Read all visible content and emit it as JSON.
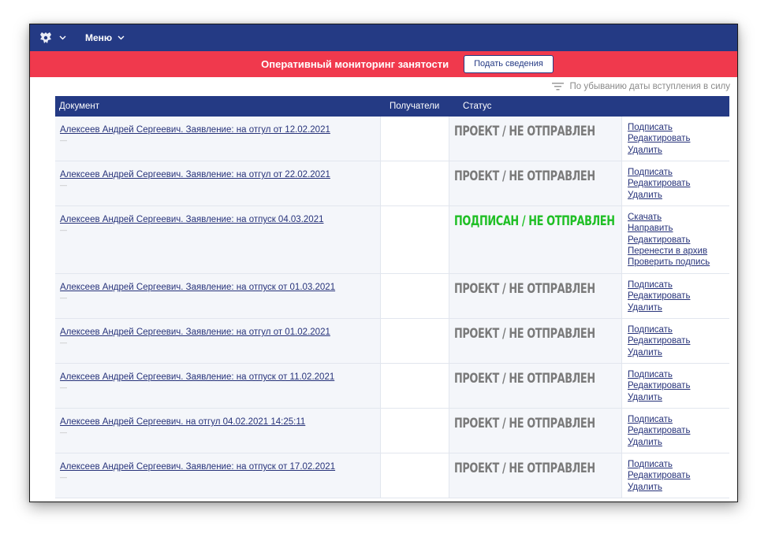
{
  "header": {
    "menu_label": "Меню",
    "emblem_icon": "russian-eagle-icon"
  },
  "banner": {
    "title": "Оперативный мониторинг занятости",
    "button_label": "Подать сведения"
  },
  "sort": {
    "label": "По убыванию даты вступления в силу",
    "icon": "sort-lines-icon"
  },
  "columns": {
    "document": "Документ",
    "recipients": "Получатели",
    "status": "Статус"
  },
  "colors": {
    "navy": "#243a84",
    "red": "#f0394d",
    "draft_status": "#7a7a7a",
    "signed_status": "#1fbf25",
    "link": "#27337a"
  },
  "rows": [
    {
      "title": "Алексеев Андрей Сергеевич. Заявление: на отгул от 12.02.2021",
      "sub": "—",
      "status": "ПРОЕКТ / НЕ ОТПРАВЛЕН",
      "status_kind": "draft",
      "actions": [
        "Подписать",
        "Редактировать",
        "Удалить"
      ]
    },
    {
      "title": "Алексеев Андрей Сергеевич. Заявление: на отгул от 22.02.2021",
      "sub": "—",
      "status": "ПРОЕКТ / НЕ ОТПРАВЛЕН",
      "status_kind": "draft",
      "actions": [
        "Подписать",
        "Редактировать",
        "Удалить"
      ]
    },
    {
      "title": "Алексеев Андрей Сергеевич. Заявление: на отпуск 04.03.2021",
      "sub": "—",
      "status": "ПОДПИСАН / НЕ ОТПРАВЛЕН",
      "status_kind": "signed",
      "actions": [
        "Скачать",
        "Направить",
        "Редактировать",
        "Перенести в архив",
        "Проверить подпись"
      ]
    },
    {
      "title": "Алексеев Андрей Сергеевич. Заявление: на отпуск от 01.03.2021",
      "sub": "—",
      "status": "ПРОЕКТ / НЕ ОТПРАВЛЕН",
      "status_kind": "draft",
      "actions": [
        "Подписать",
        "Редактировать",
        "Удалить"
      ]
    },
    {
      "title": "Алексеев Андрей Сергеевич. Заявление: на отгул от 01.02.2021",
      "sub": "—",
      "status": "ПРОЕКТ / НЕ ОТПРАВЛЕН",
      "status_kind": "draft",
      "actions": [
        "Подписать",
        "Редактировать",
        "Удалить"
      ]
    },
    {
      "title": "Алексеев Андрей Сергеевич. Заявление: на отпуск от 11.02.2021",
      "sub": "—",
      "status": "ПРОЕКТ / НЕ ОТПРАВЛЕН",
      "status_kind": "draft",
      "actions": [
        "Подписать",
        "Редактировать",
        "Удалить"
      ]
    },
    {
      "title": "Алексеев Андрей Сергеевич. на отгул 04.02.2021 14:25:11",
      "sub": "—",
      "status": "ПРОЕКТ / НЕ ОТПРАВЛЕН",
      "status_kind": "draft",
      "actions": [
        "Подписать",
        "Редактировать",
        "Удалить"
      ]
    },
    {
      "title": "Алексеев Андрей Сергеевич. Заявление: на отпуск от 17.02.2021",
      "sub": "—",
      "status": "ПРОЕКТ / НЕ ОТПРАВЛЕН",
      "status_kind": "draft",
      "actions": [
        "Подписать",
        "Редактировать",
        "Удалить"
      ]
    }
  ]
}
